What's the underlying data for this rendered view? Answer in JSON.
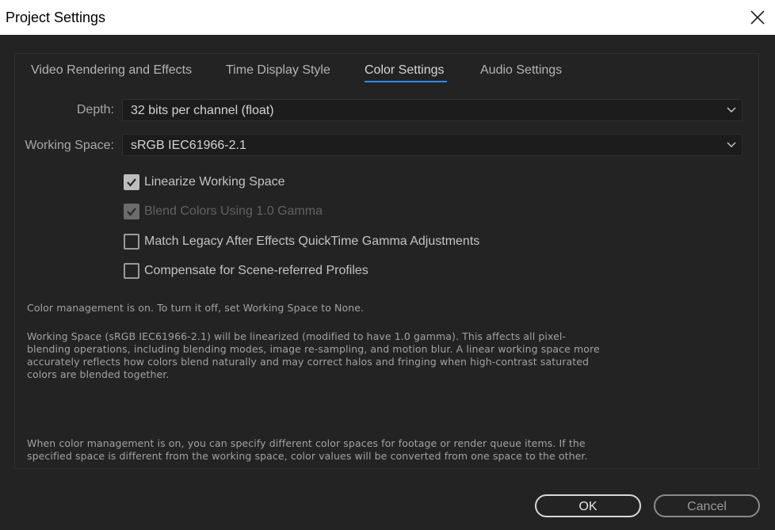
{
  "window": {
    "title": "Project Settings"
  },
  "tabs": [
    {
      "label": "Video Rendering and Effects",
      "active": false
    },
    {
      "label": "Time Display Style",
      "active": false
    },
    {
      "label": "Color Settings",
      "active": true
    },
    {
      "label": "Audio Settings",
      "active": false
    }
  ],
  "depth": {
    "label": "Depth:",
    "value": "32 bits per channel (float)"
  },
  "working_space": {
    "label": "Working Space:",
    "value": "sRGB IEC61966-2.1"
  },
  "options": [
    {
      "label": "Linearize Working Space",
      "checked": true,
      "enabled": true
    },
    {
      "label": "Blend Colors Using 1.0 Gamma",
      "checked": true,
      "enabled": false
    },
    {
      "label": "Match Legacy After Effects QuickTime Gamma Adjustments",
      "checked": false,
      "enabled": true
    },
    {
      "label": "Compensate for Scene-referred Profiles",
      "checked": false,
      "enabled": true
    }
  ],
  "info": {
    "status": "Color management is on. To turn it off, set Working Space to None.",
    "linearize_lines": [
      "Working Space (sRGB IEC61966-2.1) will be linearized (modified to have 1.0 gamma). This affects all pixel-",
      "blending operations, including blending modes, image re-sampling, and motion blur. A linear working space more",
      "accurately reflects how colors blend naturally and may correct halos and fringing when high-contrast saturated",
      "colors are blended together."
    ],
    "footage_lines": [
      "When color management is on, you can specify different color spaces for footage or render queue items. If the",
      "specified space is different from the working space, color values will be converted from one space to the other."
    ]
  },
  "buttons": {
    "ok": "OK",
    "cancel": "Cancel"
  },
  "colors": {
    "accent": "#2d8ceb",
    "background": "#232323",
    "titlebar": "#ffffff"
  },
  "icons": {
    "close": "close-icon",
    "dropdown": "chevron-down-icon",
    "check": "checkmark-icon"
  }
}
